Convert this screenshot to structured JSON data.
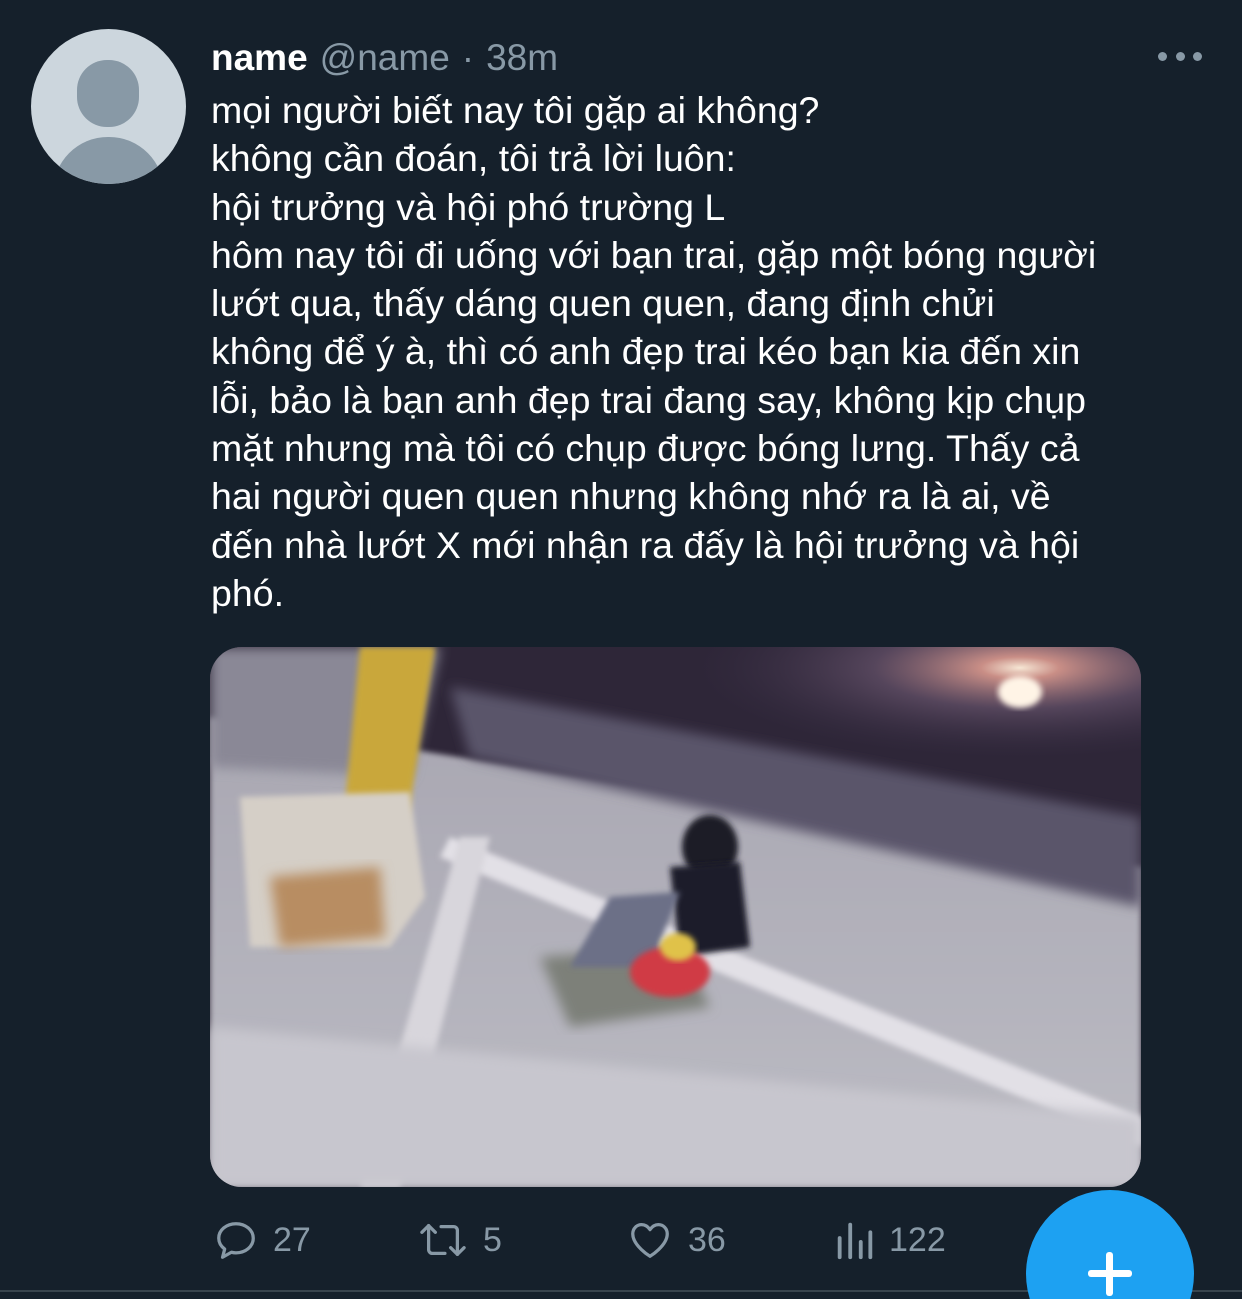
{
  "tweet": {
    "display_name": "name",
    "handle": "@name",
    "separator": "·",
    "time_ago": "38m",
    "text_lines": [
      "mọi người biết nay tôi gặp ai không?",
      "không cần đoán, tôi trả lời luôn:",
      "hội trưởng và hội phó trường L",
      "hôm nay tôi đi uống với bạn trai, gặp một bóng người",
      "lướt qua, thấy dáng quen quen, đang định chửi",
      "không để ý à, thì có anh đẹp trai kéo bạn kia đến xin",
      "lỗi, bảo là bạn anh đẹp trai đang say, không kịp chụp",
      "mặt nhưng mà tôi có chụp được bóng lưng. Thấy cả",
      "hai người quen quen nhưng không nhớ ra là ai, về",
      "đến nhà lướt X mới nhận ra đấy là hội trưởng và hội",
      "phó."
    ],
    "media_icon": "photo",
    "actions": {
      "reply": {
        "icon": "reply-icon",
        "count": "27"
      },
      "retweet": {
        "icon": "retweet-icon",
        "count": "5"
      },
      "like": {
        "icon": "heart-icon",
        "count": "36"
      },
      "views": {
        "icon": "analytics-icon",
        "count": "122"
      }
    }
  },
  "compose_fab": {
    "icon": "plus-icon"
  },
  "colors": {
    "background": "#15202b",
    "primary_text": "#ffffff",
    "secondary_text": "#8899a6",
    "accent": "#1da1f2",
    "avatar_bg": "#ccd6dd",
    "avatar_fg": "#8899a6"
  }
}
